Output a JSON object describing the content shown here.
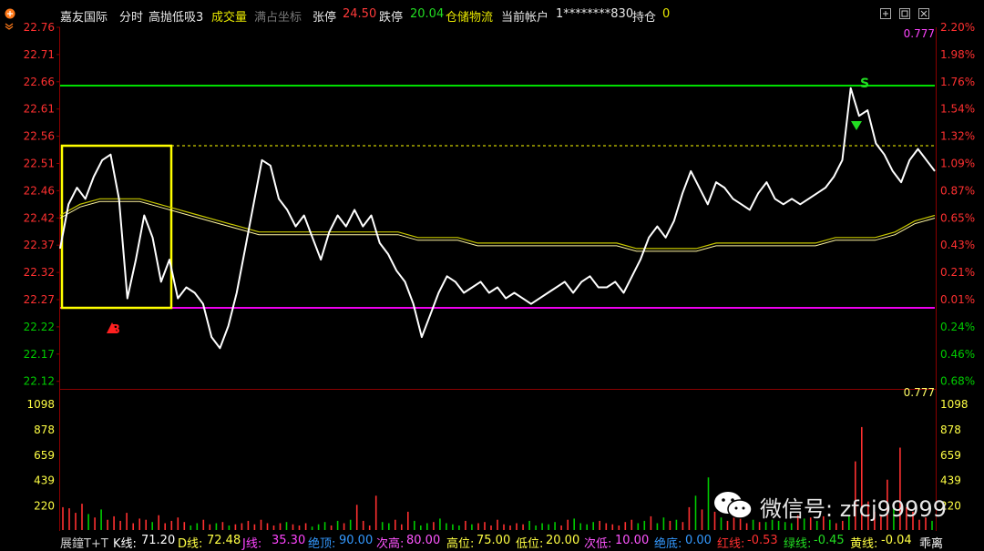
{
  "header": {
    "stock_name": "嘉友国际",
    "view": "分时",
    "indicator": "高抛低吸3",
    "volume_label": "成交量",
    "full_coord": "满占坐标",
    "limit_up_label": "张停",
    "limit_up_value": "24.50",
    "limit_down_label": "跌停",
    "limit_down_value": "20.04",
    "sector": "仓储物流",
    "account_label": "当前帐户",
    "account_value": "1********830",
    "position_label": "持仓",
    "position_value": "0"
  },
  "colors": {
    "price_line": "#ffffff",
    "avg_line": "#c8c800",
    "upper_line": "#00dd00",
    "lower_line": "#ee00ee",
    "box": "#ffff00",
    "up_volume": "#ff3030",
    "down_volume": "#00cc00",
    "axis_red": "#ff3030",
    "axis_green": "#00cc00"
  },
  "chart_data": {
    "type": "line",
    "price_axis": {
      "left_ticks": [
        "22.76",
        "22.71",
        "22.66",
        "22.61",
        "22.56",
        "22.51",
        "22.46",
        "22.42",
        "22.37",
        "22.32",
        "22.27",
        "22.22",
        "22.17",
        "22.12"
      ],
      "right_ticks": [
        "2.20%",
        "1.98%",
        "1.76%",
        "1.54%",
        "1.32%",
        "1.09%",
        "0.87%",
        "0.65%",
        "0.43%",
        "0.21%",
        "0.01%",
        "0.24%",
        "0.46%",
        "0.68%"
      ],
      "ylim": [
        22.12,
        22.76
      ]
    },
    "indicator_value_top": "0.777",
    "indicator_value_bottom": "0.777",
    "upper_level": 22.66,
    "lower_level": 22.25,
    "dotted_level": 22.53,
    "box": {
      "x_from": 1,
      "x_to": 35,
      "high": 22.53,
      "low": 22.25
    },
    "signals": [
      {
        "label": "B",
        "x": 17,
        "value": 22.25,
        "type": "buy"
      },
      {
        "label": "S",
        "x": 244,
        "value": 22.66,
        "type": "sell"
      }
    ],
    "price_series": {
      "name": "price",
      "x": [
        0,
        2,
        4,
        6,
        8,
        10,
        12,
        14,
        16,
        18,
        20,
        22,
        24,
        26,
        28,
        30,
        32,
        34,
        36,
        38,
        40,
        42,
        44,
        46,
        48,
        50,
        52,
        54,
        56,
        58,
        60,
        62,
        64,
        66,
        68,
        70,
        72,
        74,
        76,
        78,
        80,
        82,
        84,
        86,
        88,
        90,
        92,
        94,
        96,
        98,
        100,
        102,
        104,
        106,
        108,
        110,
        112,
        114,
        116,
        118,
        120,
        122,
        124,
        126,
        128,
        130,
        132,
        134,
        136,
        138,
        140,
        142,
        144,
        146,
        148,
        150,
        152,
        154,
        156,
        158,
        160,
        162,
        164,
        166,
        168,
        170,
        172,
        174,
        176,
        178,
        180,
        182,
        184,
        186,
        188,
        190,
        192,
        194,
        196,
        198,
        200,
        202,
        204,
        206,
        208,
        210,
        212,
        214,
        216,
        218,
        220,
        222,
        224,
        226,
        228,
        230,
        232,
        234,
        236,
        238,
        240,
        242,
        244,
        246,
        248,
        250,
        252,
        254,
        256,
        258,
        260,
        262,
        264,
        266,
        268,
        270,
        272,
        274
      ],
      "values": [
        22.36,
        22.44,
        22.47,
        22.45,
        22.49,
        22.52,
        22.53,
        22.45,
        22.27,
        22.34,
        22.42,
        22.38,
        22.3,
        22.34,
        22.27,
        22.29,
        22.28,
        22.26,
        22.2,
        22.18,
        22.22,
        22.28,
        22.36,
        22.44,
        22.52,
        22.51,
        22.45,
        22.43,
        22.4,
        22.42,
        22.38,
        22.34,
        22.39,
        22.42,
        22.4,
        22.43,
        22.4,
        22.42,
        22.37,
        22.35,
        22.32,
        22.3,
        22.26,
        22.2,
        22.24,
        22.28,
        22.31,
        22.3,
        22.28,
        22.29,
        22.3,
        22.28,
        22.29,
        22.27,
        22.28,
        22.27,
        22.26,
        22.27,
        22.28,
        22.29,
        22.3,
        22.28,
        22.3,
        22.31,
        22.29,
        22.29,
        22.3,
        22.28,
        22.31,
        22.34,
        22.38,
        22.4,
        22.38,
        22.41,
        22.46,
        22.5,
        22.47,
        22.44,
        22.48,
        22.47,
        22.45,
        22.44,
        22.43,
        22.46,
        22.48,
        22.45,
        22.44,
        22.45,
        22.44,
        22.45,
        22.46,
        22.47,
        22.49,
        22.52,
        22.65,
        22.6,
        22.61,
        22.55,
        22.53,
        22.5,
        22.48,
        22.52,
        22.54,
        22.52,
        22.5
      ],
      "x_note": ""
    },
    "avg_series": {
      "name": "avg",
      "values": [
        22.42,
        22.44,
        22.45,
        22.45,
        22.45,
        22.44,
        22.43,
        22.42,
        22.41,
        22.4,
        22.39,
        22.39,
        22.39,
        22.39,
        22.39,
        22.39,
        22.39,
        22.39,
        22.38,
        22.38,
        22.38,
        22.37,
        22.37,
        22.37,
        22.37,
        22.37,
        22.37,
        22.37,
        22.37,
        22.36,
        22.36,
        22.36,
        22.36,
        22.37,
        22.37,
        22.37,
        22.37,
        22.37,
        22.37,
        22.38,
        22.38,
        22.38,
        22.39,
        22.41,
        22.42
      ]
    },
    "volume_axis": {
      "left_ticks": [
        "1098",
        "878",
        "659",
        "439",
        "220"
      ],
      "right_ticks": [
        "1098",
        "878",
        "659",
        "439",
        "220"
      ],
      "ylim": [
        0,
        1098
      ]
    },
    "volume_series": {
      "name": "volume",
      "values": [
        200,
        190,
        150,
        230,
        140,
        110,
        180,
        90,
        120,
        80,
        150,
        60,
        100,
        90,
        70,
        130,
        60,
        80,
        110,
        70,
        40,
        60,
        90,
        50,
        60,
        70,
        40,
        50,
        60,
        80,
        50,
        90,
        60,
        40,
        60,
        70,
        50,
        40,
        60,
        30,
        50,
        70,
        40,
        80,
        60,
        90,
        220,
        80,
        40,
        300,
        70,
        60,
        90,
        50,
        160,
        80,
        40,
        60,
        70,
        100,
        60,
        50,
        40,
        80,
        50,
        60,
        70,
        40,
        90,
        50,
        40,
        60,
        50,
        80,
        40,
        60,
        50,
        70,
        40,
        90,
        100,
        60,
        50,
        70,
        80,
        60,
        50,
        40,
        70,
        90,
        60,
        80,
        120,
        60,
        110,
        80,
        90,
        70,
        200,
        300,
        180,
        460,
        160,
        110,
        80,
        140,
        100,
        60,
        90,
        70,
        70,
        90,
        80,
        70,
        60,
        130,
        100,
        110,
        80,
        120,
        90,
        60,
        80,
        120,
        600,
        900,
        250,
        160,
        120,
        440,
        200,
        720,
        200,
        160,
        90,
        110,
        80
      ]
    }
  },
  "footer": {
    "label": "展鐘T+T",
    "k_label": "K线:",
    "k_value": "71.20",
    "d_label": "D线:",
    "d_value": "72.48",
    "j_label": "J线:",
    "j_value": "35.30",
    "top_label": "绝顶:",
    "top_value": "90.00",
    "next_high_label": "次高:",
    "next_high_value": "80.00",
    "high_pos_label": "高位:",
    "high_pos_value": "75.00",
    "low_pos_label": "低位:",
    "low_pos_value": "20.00",
    "next_low_label": "次低:",
    "next_low_value": "10.00",
    "bottom_label": "绝底:",
    "bottom_value": "0.00",
    "red_label": "红线:",
    "red_value": "-0.53",
    "green_label": "绿线:",
    "green_value": "-0.45",
    "yellow_label": "黄线:",
    "yellow_value": "-0.04",
    "tail": "乖离"
  },
  "watermark": {
    "icon": "wechat-icon",
    "text": "微信号: zfcj99999"
  }
}
